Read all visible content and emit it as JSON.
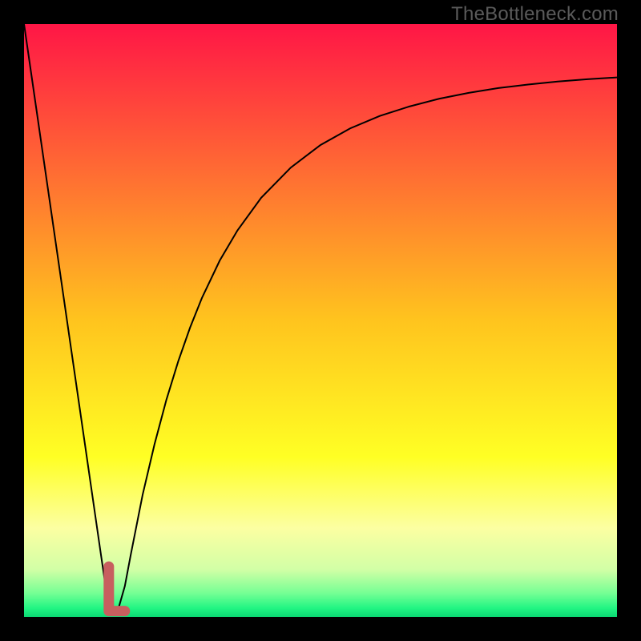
{
  "watermark": "TheBottleneck.com",
  "chart_data": {
    "type": "line",
    "title": "",
    "xlabel": "",
    "ylabel": "",
    "xlim": [
      0,
      100
    ],
    "ylim": [
      0,
      100
    ],
    "background_gradient": {
      "stops": [
        {
          "pct": 0.0,
          "color": "#ff1646"
        },
        {
          "pct": 0.25,
          "color": "#ff6c33"
        },
        {
          "pct": 0.5,
          "color": "#ffc41e"
        },
        {
          "pct": 0.73,
          "color": "#ffff24"
        },
        {
          "pct": 0.85,
          "color": "#fcffa2"
        },
        {
          "pct": 0.92,
          "color": "#d2ffa6"
        },
        {
          "pct": 0.96,
          "color": "#75ff94"
        },
        {
          "pct": 0.985,
          "color": "#22f583"
        },
        {
          "pct": 1.0,
          "color": "#0ad873"
        }
      ]
    },
    "series": [
      {
        "name": "left-descent",
        "color": "#000000",
        "stroke_width": 2,
        "x": [
          0.0,
          2.0,
          4.0,
          6.0,
          8.0,
          10.0,
          12.0,
          13.0,
          14.3,
          15.0
        ],
        "values": [
          100.0,
          86.2,
          72.4,
          58.6,
          44.8,
          31.0,
          17.2,
          10.3,
          1.5,
          0.9
        ]
      },
      {
        "name": "right-ascent",
        "color": "#000000",
        "stroke_width": 2,
        "x": [
          15.5,
          16.0,
          17.0,
          18.0,
          20.0,
          22.0,
          24.0,
          26.0,
          28.0,
          30.0,
          33.0,
          36.0,
          40.0,
          45.0,
          50.0,
          55.0,
          60.0,
          65.0,
          70.0,
          75.0,
          80.0,
          85.0,
          90.0,
          95.0,
          100.0
        ],
        "values": [
          0.9,
          1.7,
          5.2,
          10.5,
          20.6,
          29.1,
          36.6,
          43.1,
          48.8,
          53.8,
          60.1,
          65.2,
          70.7,
          75.8,
          79.6,
          82.4,
          84.5,
          86.1,
          87.4,
          88.4,
          89.2,
          89.8,
          90.3,
          90.7,
          91.0
        ]
      }
    ],
    "marker": {
      "name": "highlight",
      "color": "#c75f5f",
      "path": [
        {
          "x": 14.3,
          "y": 8.5
        },
        {
          "x": 14.3,
          "y": 1.0
        },
        {
          "x": 17.0,
          "y": 1.0
        }
      ],
      "stroke_width": 13,
      "line_cap": "round"
    }
  }
}
